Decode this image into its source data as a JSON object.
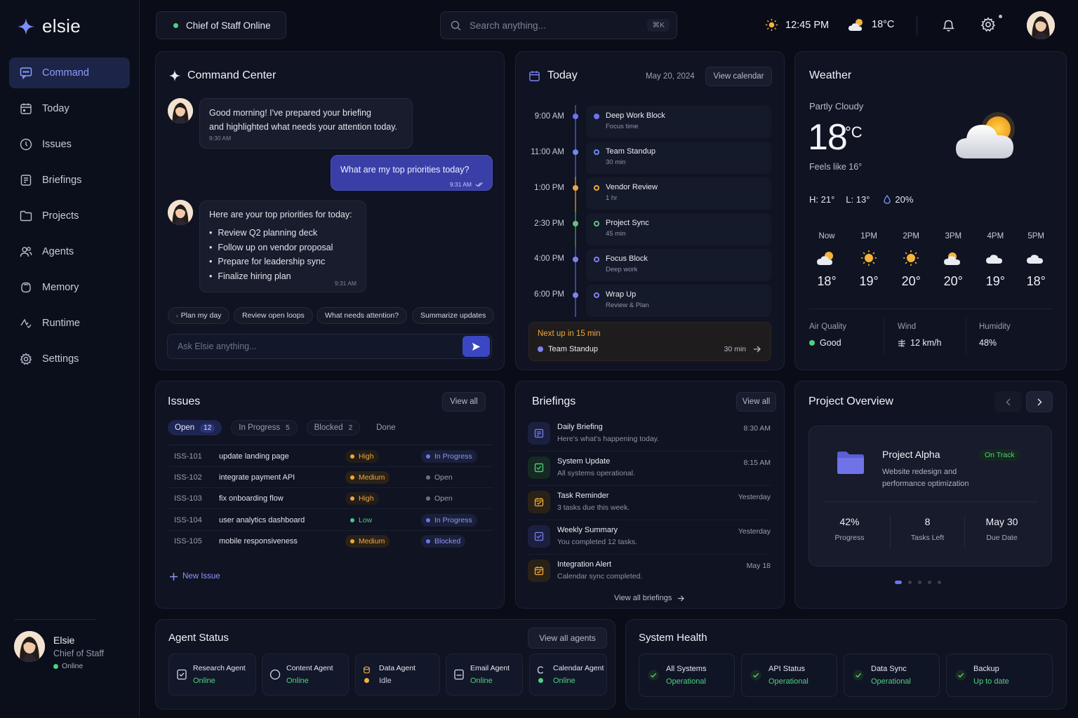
{
  "app": {
    "name": "elsie"
  },
  "sidebar": {
    "items": [
      {
        "label": "Command",
        "icon": "chat-icon",
        "active": true
      },
      {
        "label": "Today",
        "icon": "calendar-icon"
      },
      {
        "label": "Issues",
        "icon": "alert-circle-icon"
      },
      {
        "label": "Briefings",
        "icon": "briefing-icon"
      },
      {
        "label": "Projects",
        "icon": "folder-icon"
      },
      {
        "label": "Agents",
        "icon": "users-icon"
      },
      {
        "label": "Memory",
        "icon": "memory-icon"
      },
      {
        "label": "Runtime",
        "icon": "runtime-icon"
      },
      {
        "label": "Settings",
        "icon": "gear-icon"
      }
    ],
    "user": {
      "name": "Elsie",
      "role": "Chief of Staff",
      "status": "Online"
    }
  },
  "topbar": {
    "status": "Chief of Staff Online",
    "search_placeholder": "Search anything...",
    "search_shortcut": "⌘K",
    "time": "12:45 PM",
    "temp": "18°C"
  },
  "command": {
    "title": "Command Center",
    "messages": [
      {
        "from": "elsie",
        "text_1": "Good morning! I've prepared your briefing",
        "text_2": "and highlighted what needs your attention today.",
        "time": "9:30 AM"
      },
      {
        "from": "user",
        "text": "What are my top priorities today?",
        "time": "9:31 AM"
      },
      {
        "from": "elsie",
        "intro": "Here are your top priorities for today:",
        "items": [
          "Review Q2 planning deck",
          "Follow up on vendor proposal",
          "Prepare for leadership sync",
          "Finalize hiring plan"
        ],
        "time": "9:31 AM"
      }
    ],
    "chips": [
      "Plan my day",
      "Review open loops",
      "What needs attention?",
      "Summarize updates"
    ],
    "input_placeholder": "Ask Elsie anything..."
  },
  "today": {
    "title": "Today",
    "date": "May 20, 2024",
    "view_label": "View calendar",
    "events": [
      {
        "time": "9:00 AM",
        "title": "Deep Work Block",
        "sub": "Focus time",
        "color": "#6d74f0",
        "filled": true
      },
      {
        "time": "11:00 AM",
        "title": "Team Standup",
        "sub": "30 min",
        "color": "#6d8cf0",
        "filled": false
      },
      {
        "time": "1:00 PM",
        "title": "Vendor Review",
        "sub": "1 hr",
        "color": "#f0a83a",
        "filled": false
      },
      {
        "time": "2:30 PM",
        "title": "Project Sync",
        "sub": "45 min",
        "color": "#5fc37e",
        "filled": false
      },
      {
        "time": "4:00 PM",
        "title": "Focus Block",
        "sub": "Deep work",
        "color": "#7d83f2",
        "filled": false
      },
      {
        "time": "6:00 PM",
        "title": "Wrap Up",
        "sub": "Review & Plan",
        "color": "#7d83f2",
        "filled": false
      }
    ],
    "next": {
      "label": "Next up in 15 min",
      "title": "Team Standup",
      "duration": "30 min"
    }
  },
  "weather": {
    "title": "Weather",
    "condition": "Partly Cloudy",
    "temp": "18",
    "unit": "°C",
    "feels": "Feels like 16°",
    "high": "H: 21°",
    "low": "L: 13°",
    "rain": "20%",
    "hourly": [
      {
        "label": "Now",
        "temp": "18°",
        "icon": "partly-cloudy-icon"
      },
      {
        "label": "1PM",
        "temp": "19°",
        "icon": "sun-icon"
      },
      {
        "label": "2PM",
        "temp": "20°",
        "icon": "sun-icon"
      },
      {
        "label": "3PM",
        "temp": "20°",
        "icon": "partly-cloudy-icon"
      },
      {
        "label": "4PM",
        "temp": "19°",
        "icon": "cloud-icon"
      },
      {
        "label": "5PM",
        "temp": "18°",
        "icon": "cloud-icon"
      }
    ],
    "aq_label": "Air Quality",
    "aq_value": "Good",
    "wind_label": "Wind",
    "wind_value": "12 km/h",
    "humidity_label": "Humidity",
    "humidity_value": "48%"
  },
  "issues": {
    "title": "Issues",
    "view_all": "View all",
    "tabs": [
      {
        "label": "Open",
        "count": "12",
        "active": true
      },
      {
        "label": "In Progress",
        "count": "5"
      },
      {
        "label": "Blocked",
        "count": "2"
      },
      {
        "label": "Done",
        "count": ""
      }
    ],
    "rows": [
      {
        "id": "ISS-101",
        "title": "update landing page",
        "priority": "High",
        "status": "In Progress"
      },
      {
        "id": "ISS-102",
        "title": "integrate payment API",
        "priority": "Medium",
        "status": "Open"
      },
      {
        "id": "ISS-103",
        "title": "fix onboarding flow",
        "priority": "High",
        "status": "Open"
      },
      {
        "id": "ISS-104",
        "title": "user analytics dashboard",
        "priority": "Low",
        "status": "In Progress"
      },
      {
        "id": "ISS-105",
        "title": "mobile responsiveness",
        "priority": "Medium",
        "status": "Blocked"
      }
    ],
    "new_label": "New Issue"
  },
  "briefings": {
    "title": "Briefings",
    "view_all": "View all",
    "items": [
      {
        "title": "Daily Briefing",
        "sub": "Here's what's happening today.",
        "time": "8:30 AM",
        "color": "#7a80f0"
      },
      {
        "title": "System Update",
        "sub": "All systems operational.",
        "time": "8:15 AM",
        "color": "#4fc77e"
      },
      {
        "title": "Task Reminder",
        "sub": "3 tasks due this week.",
        "time": "Yesterday",
        "color": "#f0a83a"
      },
      {
        "title": "Weekly Summary",
        "sub": "You completed 12 tasks.",
        "time": "Yesterday",
        "color": "#7a80f0"
      },
      {
        "title": "Integration Alert",
        "sub": "Calendar sync completed.",
        "time": "May 18",
        "color": "#f0a83a"
      }
    ],
    "footer": "View all briefings"
  },
  "project": {
    "title": "Project Overview",
    "name": "Project Alpha",
    "status": "On Track",
    "desc_1": "Website redesign and",
    "desc_2": "performance optimization",
    "stats": [
      {
        "value": "42%",
        "label": "Progress"
      },
      {
        "value": "8",
        "label": "Tasks Left"
      },
      {
        "value": "May 30",
        "label": "Due Date"
      }
    ]
  },
  "agents": {
    "title": "Agent Status",
    "view_all": "View all agents",
    "items": [
      {
        "name": "Research Agent",
        "status": "Online",
        "color": "#4fd07e"
      },
      {
        "name": "Content Agent",
        "status": "Online",
        "color": "#4fd07e"
      },
      {
        "name": "Data Agent",
        "status": "Idle",
        "color": "#f0b03a"
      },
      {
        "name": "Email Agent",
        "status": "Online",
        "color": "#4fd07e"
      },
      {
        "name": "Calendar Agent",
        "status": "Online",
        "color": "#4fd07e"
      }
    ]
  },
  "system": {
    "title": "System Health",
    "items": [
      {
        "name": "All Systems",
        "status": "Operational"
      },
      {
        "name": "API Status",
        "status": "Operational"
      },
      {
        "name": "Data Sync",
        "status": "Operational"
      },
      {
        "name": "Backup",
        "status": "Up to date"
      }
    ]
  },
  "colors": {
    "accent": "#3b46c2",
    "success": "#4fd07e",
    "warning": "#f0a83a",
    "bg": "#0a0d18"
  }
}
